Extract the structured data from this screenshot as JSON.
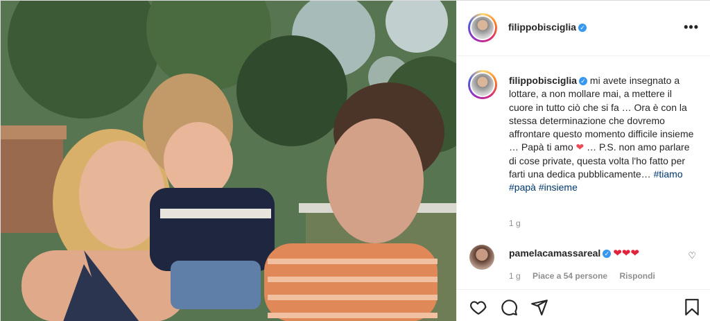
{
  "post": {
    "image_alt": "Family photo of a woman, a child and a man smiling outdoors"
  },
  "header": {
    "username": "filippobisciglia",
    "verified_icon": "verified-badge-icon",
    "more_label": "•••"
  },
  "caption": {
    "username": "filippobisciglia",
    "text_part1": "mi avete insegnato a lottare, a non mollare mai, a mettere il cuore in tutto ciò che si fa … Ora è con la stessa determinazione che dovremo affrontare questo momento difficile insieme … Papà ti amo ",
    "heart": "❤",
    "text_part2": " … P.S. non amo parlare di cose private, questa volta l'ho fatto per farti una dedica pubblicamente… ",
    "hashtags": [
      "#tiamo",
      "#papà",
      "#insieme"
    ],
    "time": "1 g"
  },
  "comment": {
    "username": "pamelacamassareal",
    "hearts": "❤❤❤",
    "like_icon": "♡",
    "time": "1 g",
    "likes": "Piace a 54 persone",
    "reply": "Rispondi"
  },
  "actions": {
    "like_icon": "heart-outline-icon",
    "comment_icon": "comment-icon",
    "share_icon": "share-icon",
    "save_icon": "bookmark-icon"
  },
  "colors": {
    "username": "#262626",
    "hashtag": "#00376b",
    "muted": "#8e8e8e",
    "verified": "#3897f0",
    "heart": "#ed4956"
  }
}
